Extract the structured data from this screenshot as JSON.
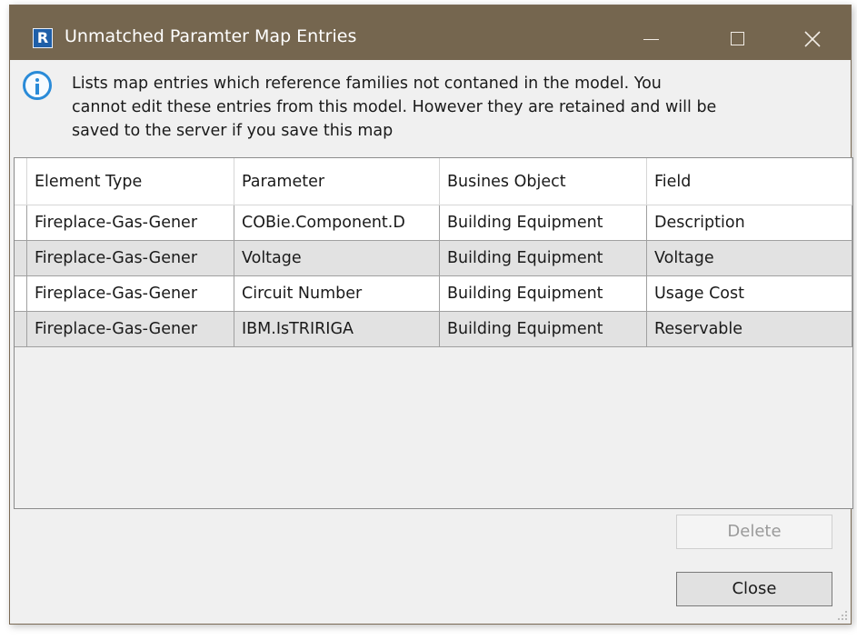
{
  "window": {
    "app_icon_letter": "R",
    "title": "Unmatched Paramter Map Entries",
    "titlebar_color": "#75664f"
  },
  "info": {
    "icon": "info-icon",
    "lines": [
      "Lists map entries which reference families not contaned in the model.  You",
      "cannot edit these entries from this model.  However they are retained and will be",
      "saved to the server if you save this map"
    ]
  },
  "table": {
    "headers": [
      "Element Type",
      "Parameter",
      "Busines Object",
      "Field"
    ],
    "rows": [
      [
        "Fireplace-Gas-Gener",
        "COBie.Component.D",
        "Building Equipment",
        "Description"
      ],
      [
        "Fireplace-Gas-Gener",
        "Voltage",
        "Building Equipment",
        "Voltage"
      ],
      [
        "Fireplace-Gas-Gener",
        "Circuit Number",
        "Building Equipment",
        "Usage Cost"
      ],
      [
        "Fireplace-Gas-Gener",
        "IBM.IsTRIRIGA",
        "Building Equipment",
        "Reservable"
      ]
    ]
  },
  "buttons": {
    "delete_label": "Delete",
    "close_label": "Close"
  }
}
